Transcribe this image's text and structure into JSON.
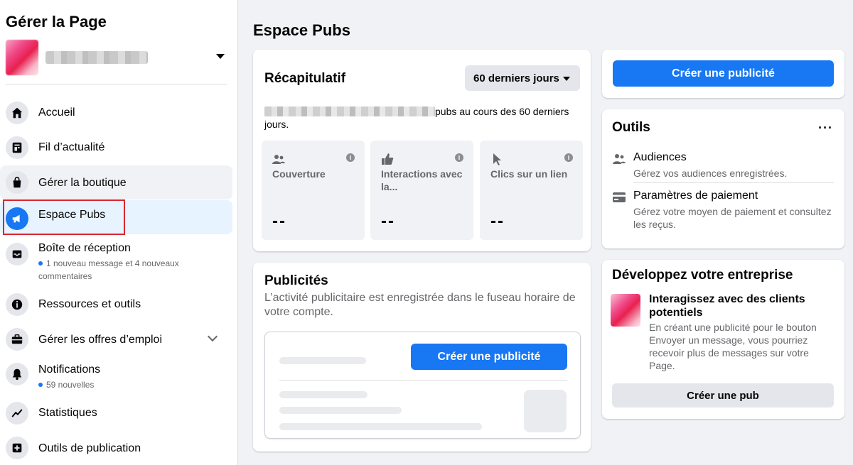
{
  "sidebar": {
    "title": "Gérer la Page",
    "items": [
      {
        "label": "Accueil"
      },
      {
        "label": "Fil d’actualité"
      },
      {
        "label": "Gérer la boutique"
      },
      {
        "label": "Espace Pubs"
      },
      {
        "label": "Boîte de réception",
        "sub": "1 nouveau message et 4 nouveaux commentaires"
      },
      {
        "label": "Ressources et outils"
      },
      {
        "label": "Gérer les offres d’emploi"
      },
      {
        "label": "Notifications",
        "sub": "59 nouvelles"
      },
      {
        "label": "Statistiques"
      },
      {
        "label": "Outils de publication"
      }
    ]
  },
  "main": {
    "title": "Espace Pubs",
    "recap": {
      "title": "Récapitulatif",
      "period_label": "60 derniers jours",
      "summary_suffix": "pubs au cours des 60 derniers jours.",
      "metrics": [
        {
          "label": "Couverture",
          "value": "--"
        },
        {
          "label": "Interactions avec la...",
          "value": "--"
        },
        {
          "label": "Clics sur un lien",
          "value": "--"
        }
      ]
    },
    "ads": {
      "title": "Publicités",
      "description": "L’activité publicitaire est enregistrée dans le fuseau horaire de votre compte.",
      "create_label": "Créer une publicité"
    }
  },
  "right": {
    "create_label": "Créer une publicité",
    "tools": {
      "title": "Outils",
      "more": "···",
      "items": [
        {
          "title": "Audiences",
          "desc": "Gérez vos audiences enregistrées."
        },
        {
          "title": "Paramètres de paiement",
          "desc": "Gérez votre moyen de paiement et consultez les reçus."
        }
      ]
    },
    "develop": {
      "title": "Développez votre entreprise",
      "headline": "Interagissez avec des clients potentiels",
      "desc": "En créant une publicité pour le bouton Envoyer un message, vous pourriez recevoir plus de messages sur votre Page.",
      "button_label": "Créer une pub"
    }
  },
  "colors": {
    "accent": "#1877f2",
    "highlight": "#d9262f",
    "active_bg": "#e7f3ff"
  }
}
